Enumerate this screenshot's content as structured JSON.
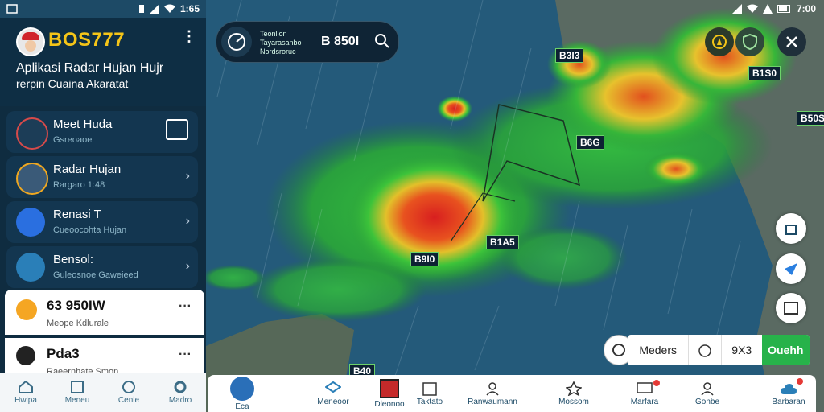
{
  "status_left": {
    "time": "1:65"
  },
  "status_right": {
    "time": "7:00"
  },
  "app": {
    "name": "BOS777",
    "subtitle_line1": "Aplikasi Radar Hujan Hujr",
    "subtitle_line2": "rerpin Cuaina Akaratat"
  },
  "sidebar": {
    "items": [
      {
        "title": "Meet Huda",
        "sub": "Gsreoaoe"
      },
      {
        "title": "Radar Hujan",
        "sub": "Rargaro 1:48"
      },
      {
        "title": "Renasi T",
        "sub": "Cueoocohta Hujan"
      },
      {
        "title": "Bensol:",
        "sub": "Guleosnoe Gaweieed"
      }
    ],
    "cards": [
      {
        "title": "63 950IW",
        "sub": "Meope Kdlurale"
      },
      {
        "title": "Pda3",
        "sub": "Raeernhate Smon"
      }
    ],
    "nav": [
      "Hwlpa",
      "Meneu",
      "Cenle",
      "Madro"
    ]
  },
  "search": {
    "label": "Teonlion Tayarasanbo Nordsroruc",
    "value": "B 850I"
  },
  "map_labels": [
    "B3I3",
    "B6G",
    "B1S0",
    "B50S",
    "B1A5",
    "B9I0",
    "B40"
  ],
  "mode_bar": {
    "meters": "Meders",
    "value": "9X3",
    "action": "Ouehh"
  },
  "bottom_nav": [
    "Eca",
    "Meneoor",
    "Dleonoo",
    "Taktato",
    "Ranwaumann",
    "Mossom",
    "Marfara",
    "Gonbe",
    "Barbaran"
  ],
  "colors": {
    "accent_green": "#27b24a",
    "brand_yellow": "#f5c518",
    "sidebar_bg": "#0f2c40"
  }
}
